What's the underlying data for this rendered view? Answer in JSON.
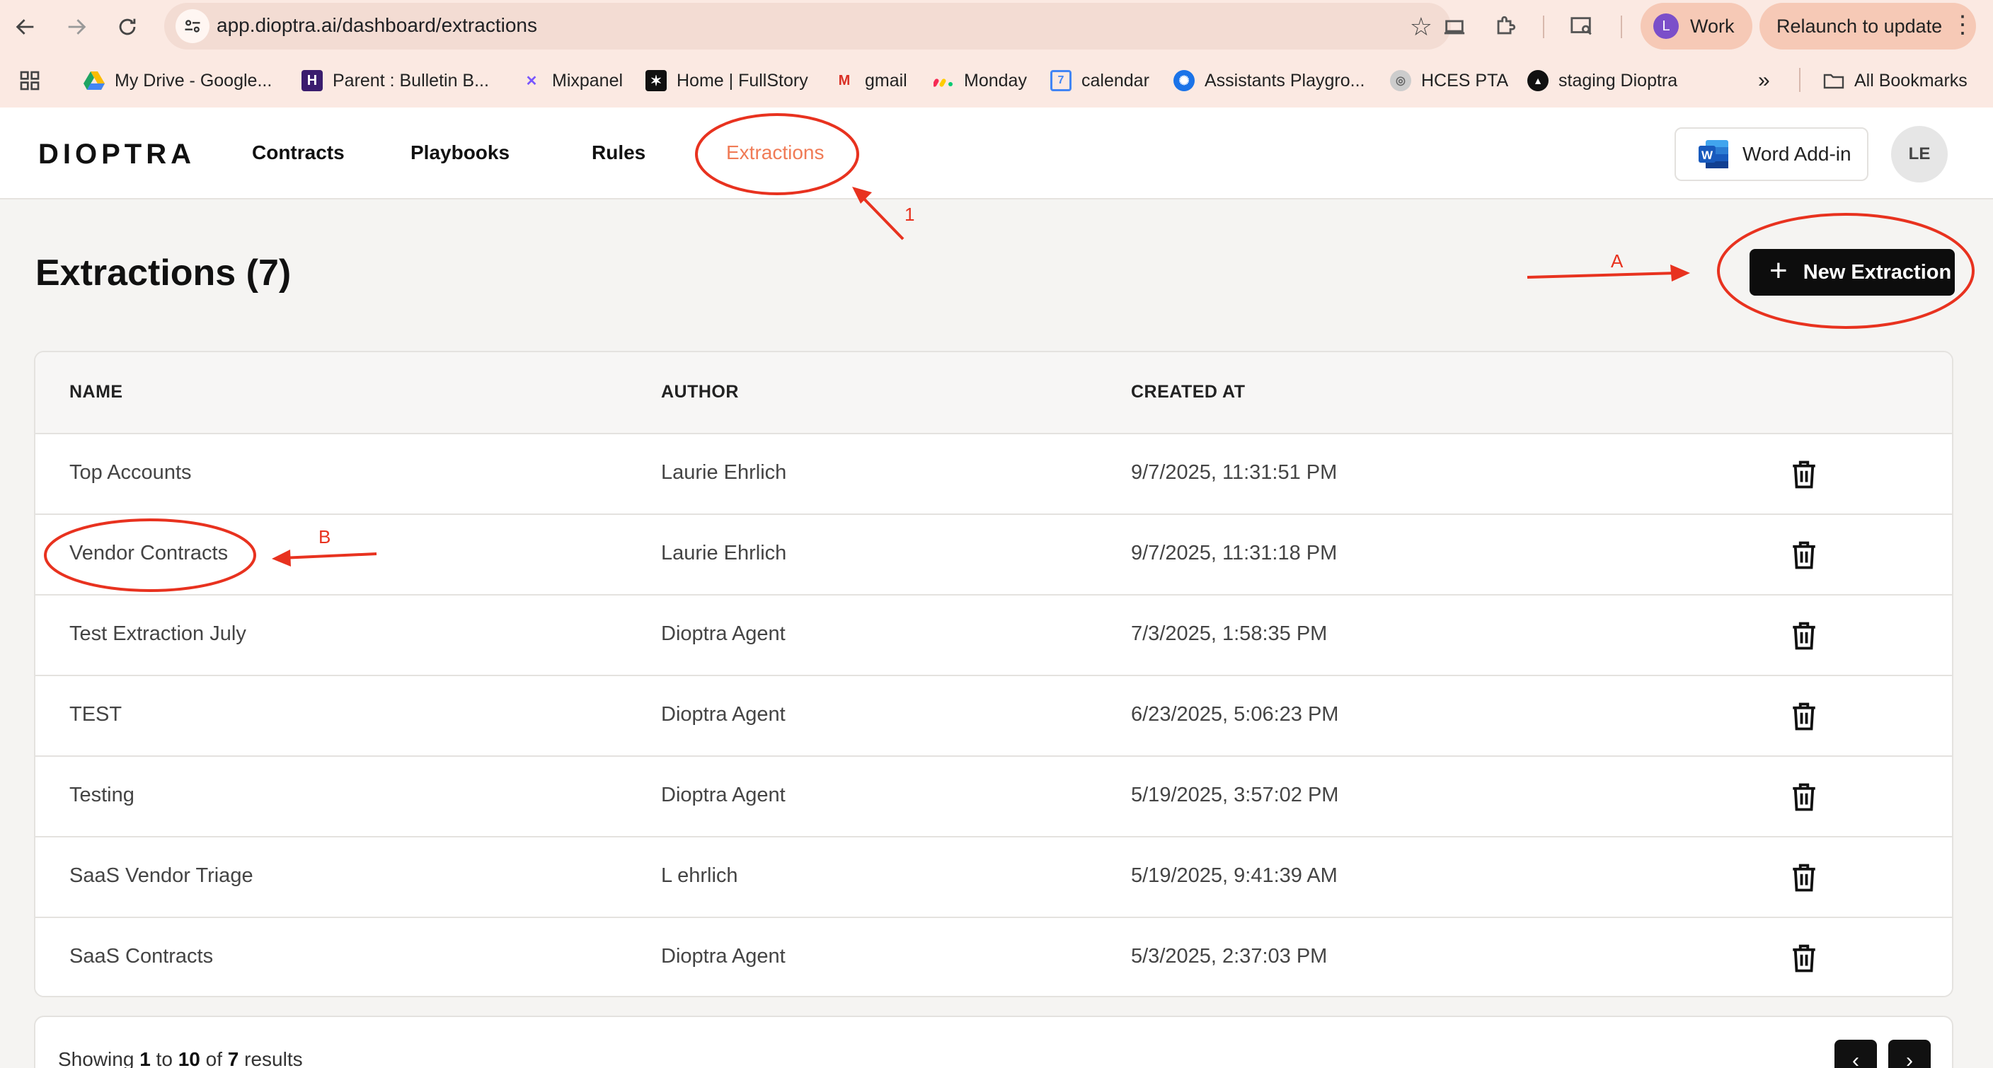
{
  "browser": {
    "url": "app.dioptra.ai/dashboard/extractions",
    "profile_initial": "L",
    "profile_name": "Work",
    "relaunch_label": "Relaunch to update",
    "bookmarks": [
      {
        "label": "My Drive - Google...",
        "icon": "google-drive-icon"
      },
      {
        "label": "Parent : Bulletin B...",
        "icon": "bulletin-icon"
      },
      {
        "label": "Mixpanel",
        "icon": "mixpanel-icon"
      },
      {
        "label": "Home | FullStory",
        "icon": "fullstory-icon"
      },
      {
        "label": "gmail",
        "icon": "gmail-icon"
      },
      {
        "label": "Monday",
        "icon": "monday-icon"
      },
      {
        "label": "calendar",
        "icon": "calendar-icon"
      },
      {
        "label": "Assistants Playgro...",
        "icon": "openai-icon"
      },
      {
        "label": "HCES PTA",
        "icon": "school-icon"
      },
      {
        "label": "staging Dioptra",
        "icon": "dioptra-icon"
      }
    ],
    "calendar_day": "7",
    "all_bookmarks_label": "All Bookmarks"
  },
  "header": {
    "logo": "DIOPTRA",
    "nav": [
      "Contracts",
      "Playbooks",
      "Rules",
      "Extractions"
    ],
    "word_addin_label": "Word Add-in",
    "avatar_initials": "LE",
    "accent_color": "#f07b56"
  },
  "page": {
    "title": "Extractions (7)",
    "new_button_label": "New Extraction"
  },
  "table": {
    "columns": [
      "NAME",
      "AUTHOR",
      "CREATED AT"
    ],
    "rows": [
      {
        "name": "Top Accounts",
        "author": "Laurie Ehrlich",
        "created_at": "9/7/2025, 11:31:51 PM"
      },
      {
        "name": "Vendor Contracts",
        "author": "Laurie Ehrlich",
        "created_at": "9/7/2025, 11:31:18 PM"
      },
      {
        "name": "Test Extraction July",
        "author": "Dioptra Agent",
        "created_at": "7/3/2025, 1:58:35 PM"
      },
      {
        "name": "TEST",
        "author": "Dioptra Agent",
        "created_at": "6/23/2025, 5:06:23 PM"
      },
      {
        "name": "Testing",
        "author": "Dioptra Agent",
        "created_at": "5/19/2025, 3:57:02 PM"
      },
      {
        "name": "SaaS Vendor Triage",
        "author": "L ehrlich",
        "created_at": "5/19/2025, 9:41:39 AM"
      },
      {
        "name": "SaaS Contracts",
        "author": "Dioptra Agent",
        "created_at": "5/3/2025, 2:37:03 PM"
      }
    ]
  },
  "pagination": {
    "prefix": "Showing ",
    "from": "1",
    "to_word": " to ",
    "to": "10",
    "of_word": " of ",
    "total": "7",
    "suffix": " results"
  },
  "annotations": {
    "color": "#e8321f",
    "labels": [
      "1",
      "A",
      "B"
    ]
  }
}
